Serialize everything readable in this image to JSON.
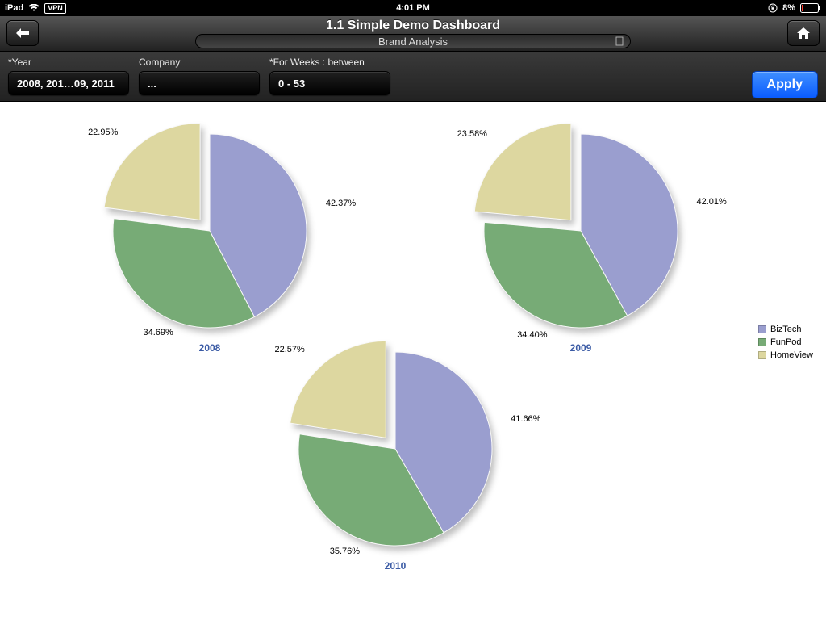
{
  "status": {
    "device": "iPad",
    "vpn": "VPN",
    "time": "4:01 PM",
    "battery": "8%"
  },
  "nav": {
    "title": "1.1 Simple Demo Dashboard",
    "subtitle": "Brand Analysis"
  },
  "filters": {
    "year": {
      "label": "*Year",
      "value": "2008, 201…09, 2011"
    },
    "company": {
      "label": "Company",
      "value": "..."
    },
    "weeks": {
      "label": "*For Weeks : between",
      "value": "0 - 53"
    },
    "apply": "Apply"
  },
  "colors": {
    "biztech": "#9a9ecf",
    "funpod": "#77ab76",
    "homeview": "#ddd7a0"
  },
  "legend": [
    "BizTech",
    "FunPod",
    "HomeView"
  ],
  "chart_data": [
    {
      "type": "pie",
      "year": "2008",
      "series": [
        {
          "name": "BizTech",
          "value": 42.37,
          "label": "42.37%"
        },
        {
          "name": "FunPod",
          "value": 34.69,
          "label": "34.69%"
        },
        {
          "name": "HomeView",
          "value": 22.95,
          "label": "22.95%"
        }
      ]
    },
    {
      "type": "pie",
      "year": "2009",
      "series": [
        {
          "name": "BizTech",
          "value": 42.01,
          "label": "42.01%"
        },
        {
          "name": "FunPod",
          "value": 34.4,
          "label": "34.40%"
        },
        {
          "name": "HomeView",
          "value": 23.58,
          "label": "23.58%"
        }
      ]
    },
    {
      "type": "pie",
      "year": "2010",
      "series": [
        {
          "name": "BizTech",
          "value": 41.66,
          "label": "41.66%"
        },
        {
          "name": "FunPod",
          "value": 35.76,
          "label": "35.76%"
        },
        {
          "name": "HomeView",
          "value": 22.57,
          "label": "22.57%"
        }
      ]
    }
  ]
}
